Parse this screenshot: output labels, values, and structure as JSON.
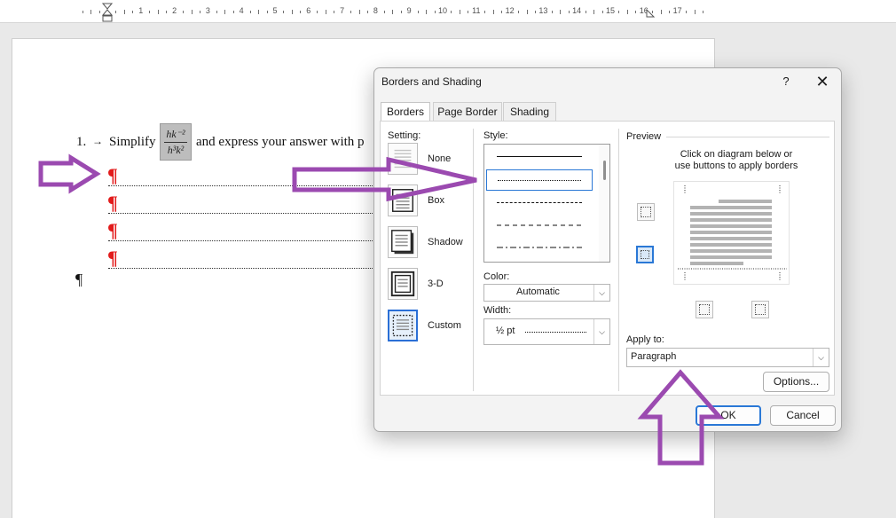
{
  "ruler": {
    "numbers": [
      "1",
      "2",
      "3",
      "4",
      "5",
      "6",
      "7",
      "8",
      "9",
      "10",
      "11",
      "12",
      "13",
      "14",
      "15",
      "16",
      "17"
    ]
  },
  "document": {
    "list_number": "1.",
    "tab_arrow": "→",
    "text_before": "Simplify",
    "equation_numerator": "hk⁻²",
    "equation_denominator": "h³k²",
    "text_after": "and express your answer with p",
    "red_pilcrow": "¶",
    "end_pilcrow": "¶"
  },
  "dialog": {
    "title": "Borders and Shading",
    "help_label": "?",
    "close_label": "✕",
    "tabs": [
      {
        "label": "Borders",
        "active": true
      },
      {
        "label": "Page Border",
        "active": false
      },
      {
        "label": "Shading",
        "active": false
      }
    ],
    "setting": {
      "label": "Setting:",
      "items": [
        {
          "label": "None",
          "selected": false
        },
        {
          "label": "Box",
          "selected": false
        },
        {
          "label": "Shadow",
          "selected": false
        },
        {
          "label": "3-D",
          "selected": false
        },
        {
          "label": "Custom",
          "selected": true
        }
      ]
    },
    "style": {
      "label": "Style:",
      "options": [
        "solid",
        "dotted",
        "dashed-fine",
        "dashed",
        "dash-dot"
      ],
      "selected_index": 1
    },
    "color": {
      "label": "Color:",
      "value": "Automatic"
    },
    "width": {
      "label": "Width:",
      "value": "½ pt"
    },
    "preview": {
      "label": "Preview",
      "hint_line1": "Click on diagram below or",
      "hint_line2": "use buttons to apply borders"
    },
    "apply_to": {
      "label": "Apply to:",
      "value": "Paragraph"
    },
    "options_button": "Options...",
    "ok_button": "OK",
    "cancel_button": "Cancel"
  },
  "colors": {
    "annotation_arrow": "#9b4ab0",
    "pilcrow_red": "#e21b1b",
    "accent_blue": "#2a78d6"
  }
}
